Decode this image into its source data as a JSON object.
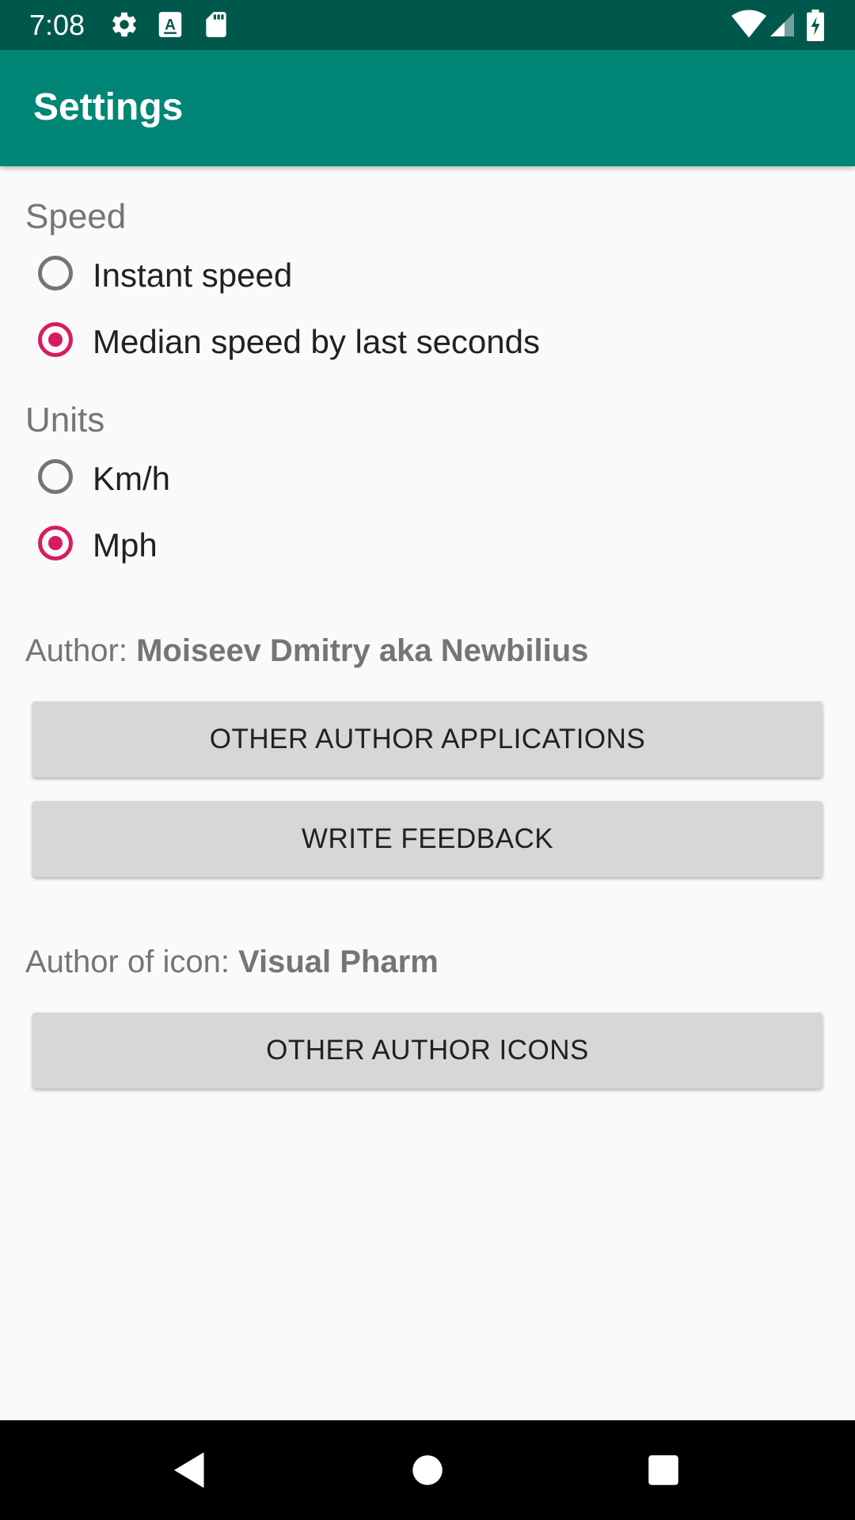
{
  "status_bar": {
    "time": "7:08",
    "left_icons": [
      "gear-icon",
      "a-box-icon",
      "sd-card-icon"
    ],
    "right_icons": [
      "wifi-icon",
      "cell-signal-icon",
      "battery-charging-icon"
    ]
  },
  "app_bar": {
    "title": "Settings"
  },
  "speed": {
    "label": "Speed",
    "options": [
      {
        "label": "Instant speed",
        "checked": false
      },
      {
        "label": "Median speed by last seconds",
        "checked": true
      }
    ]
  },
  "units": {
    "label": "Units",
    "options": [
      {
        "label": "Km/h",
        "checked": false
      },
      {
        "label": "Mph",
        "checked": true
      }
    ]
  },
  "author": {
    "prefix": "Author: ",
    "name": "Moiseev Dmitry aka Newbilius",
    "buttons": {
      "apps": "OTHER AUTHOR APPLICATIONS",
      "feedback": "WRITE FEEDBACK"
    }
  },
  "icon_author": {
    "prefix": "Author of icon: ",
    "name": "Visual Pharm",
    "buttons": {
      "icons": "OTHER AUTHOR ICONS"
    }
  },
  "nav_bar": {
    "icons": [
      "back-icon",
      "home-icon",
      "recents-icon"
    ]
  },
  "colors": {
    "primary": "#008577",
    "primary_dark": "#00574B",
    "accent": "#D81B60",
    "background": "#FAFAFA"
  }
}
